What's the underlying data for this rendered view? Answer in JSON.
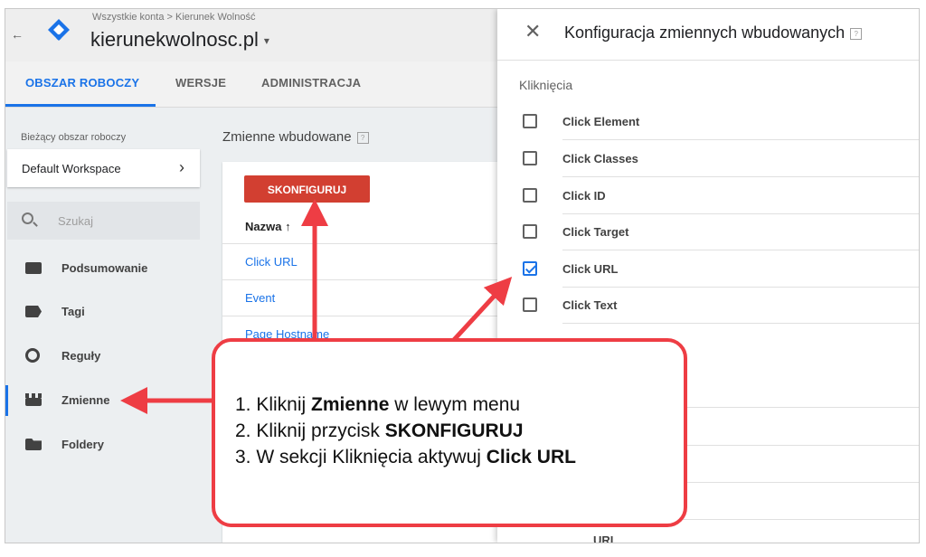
{
  "header": {
    "back_arrow": "←",
    "breadcrumb": "Wszystkie konta > Kierunek Wolność",
    "account": "kierunekwolnosc.pl",
    "caret": "▾"
  },
  "tabs": [
    "OBSZAR ROBOCZY",
    "WERSJE",
    "ADMINISTRACJA"
  ],
  "sidebar": {
    "workspace_label": "Bieżący obszar roboczy",
    "workspace_name": "Default Workspace",
    "workspace_chevron": "›",
    "search_placeholder": "Szukaj",
    "items": [
      {
        "label": "Podsumowanie",
        "icon": "summary-icon"
      },
      {
        "label": "Tagi",
        "icon": "tag-icon"
      },
      {
        "label": "Reguły",
        "icon": "trigger-icon"
      },
      {
        "label": "Zmienne",
        "icon": "variables-icon"
      },
      {
        "label": "Foldery",
        "icon": "folder-icon"
      }
    ]
  },
  "main": {
    "title": "Zmienne wbudowane",
    "help": "?",
    "configure_button": "SKONFIGURUJ",
    "column_header": "Nazwa ↑",
    "rows": [
      "Click URL",
      "Event",
      "Page Hostname"
    ]
  },
  "panel": {
    "close": "✕",
    "title": "Konfiguracja zmiennych wbudowanych",
    "help": "?",
    "section": "Kliknięcia",
    "items": [
      {
        "label": "Click Element",
        "checked": false
      },
      {
        "label": "Click Classes",
        "checked": false
      },
      {
        "label": "Click ID",
        "checked": false
      },
      {
        "label": "Click Target",
        "checked": false
      },
      {
        "label": "Click URL",
        "checked": true
      },
      {
        "label": "Click Text",
        "checked": false
      }
    ],
    "tail": "URL"
  },
  "callout": {
    "step1": [
      "1. Kliknij ",
      "Zmienne",
      " w lewym menu"
    ],
    "step2": [
      "2. Kliknij przycisk ",
      "SKONFIGURUJ"
    ],
    "step3": [
      "3. W sekcji Kliknięcia aktywuj ",
      "Click URL"
    ]
  },
  "colors": {
    "accent": "#1a73e8",
    "button": "#d23f31",
    "callout": "#ee3d44"
  }
}
